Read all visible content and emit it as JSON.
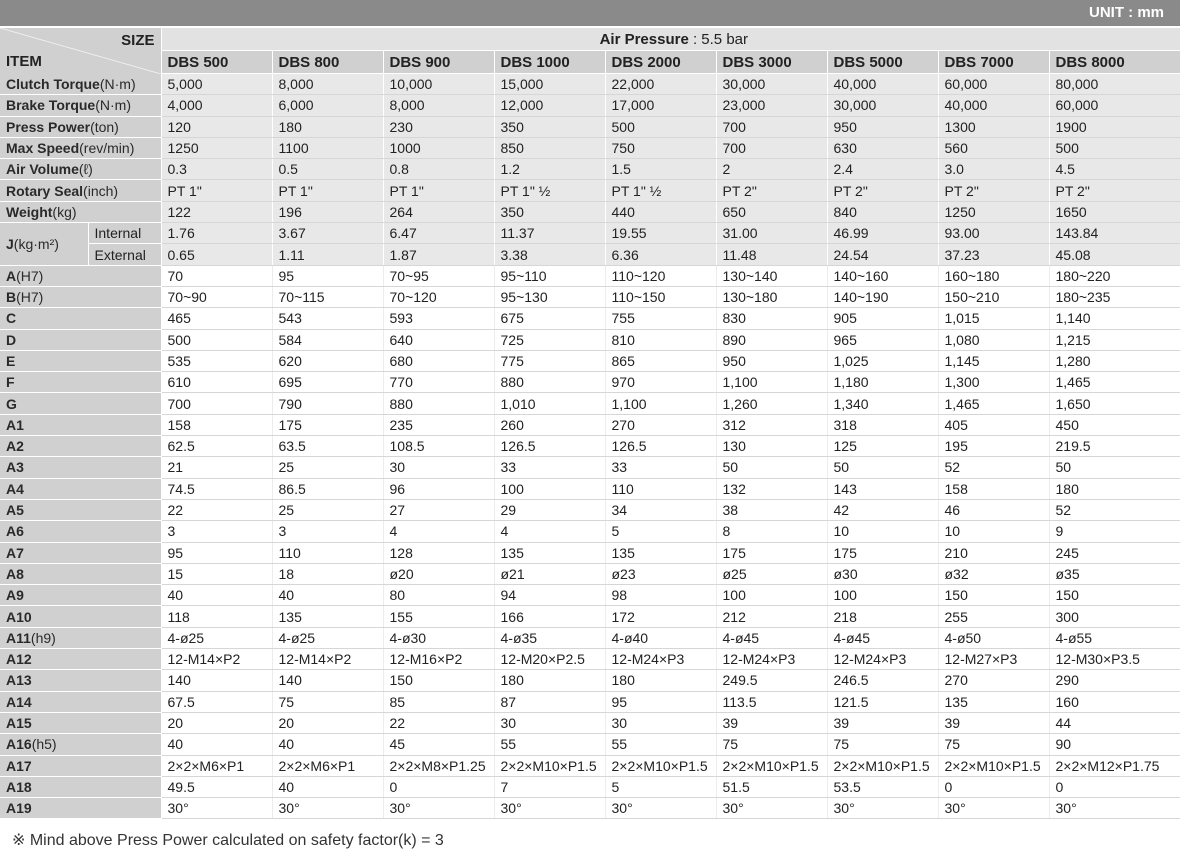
{
  "unit": "UNIT : mm",
  "header": {
    "size_label": "SIZE",
    "item_label": "ITEM",
    "air_pressure_label": "Air Pressure",
    "air_pressure_value": " : 5.5 bar",
    "models": [
      "DBS 500",
      "DBS 800",
      "DBS 900",
      "DBS 1000",
      "DBS 2000",
      "DBS 3000",
      "DBS 5000",
      "DBS 7000",
      "DBS 8000"
    ]
  },
  "groups": [
    {
      "rows": [
        {
          "label": "Clutch Torque",
          "unit": "(N·m)",
          "values": [
            "5,000",
            "8,000",
            "10,000",
            "15,000",
            "22,000",
            "30,000",
            "40,000",
            "60,000",
            "80,000"
          ]
        },
        {
          "label": "Brake Torque",
          "unit": "(N·m)",
          "values": [
            "4,000",
            "6,000",
            "8,000",
            "12,000",
            "17,000",
            "23,000",
            "30,000",
            "40,000",
            "60,000"
          ]
        },
        {
          "label": "Press Power",
          "unit": "(ton)",
          "values": [
            "120",
            "180",
            "230",
            "350",
            "500",
            "700",
            "950",
            "1300",
            "1900"
          ]
        },
        {
          "label": "Max Speed",
          "unit": "(rev/min)",
          "values": [
            "1250",
            "1100",
            "1000",
            "850",
            "750",
            "700",
            "630",
            "560",
            "500"
          ]
        },
        {
          "label": "Air Volume",
          "unit": "(ℓ)",
          "values": [
            "0.3",
            "0.5",
            "0.8",
            "1.2",
            "1.5",
            "2",
            "2.4",
            "3.0",
            "4.5"
          ]
        },
        {
          "label": "Rotary Seal",
          "unit": "(inch)",
          "values": [
            "PT 1\"",
            "PT 1\"",
            "PT 1\"",
            "PT 1\" ½",
            "PT 1\" ½",
            "PT 2\"",
            "PT 2\"",
            "PT 2\"",
            "PT 2\""
          ]
        },
        {
          "label": "Weight",
          "unit": "(kg)",
          "values": [
            "122",
            "196",
            "264",
            "350",
            "440",
            "650",
            "840",
            "1250",
            "1650"
          ]
        }
      ],
      "j_label": "J",
      "j_unit": "(kg·m²)",
      "j_rows": [
        {
          "label": "Internal",
          "values": [
            "1.76",
            "3.67",
            "6.47",
            "11.37",
            "19.55",
            "31.00",
            "46.99",
            "93.00",
            "143.84"
          ]
        },
        {
          "label": "External",
          "values": [
            "0.65",
            "1.11",
            "1.87",
            "3.38",
            "6.36",
            "11.48",
            "24.54",
            "37.23",
            "45.08"
          ]
        }
      ]
    },
    {
      "rows": [
        {
          "label": "A",
          "unit": "(H7)",
          "values": [
            "70",
            "95",
            "70~95",
            "95~110",
            "110~120",
            "130~140",
            "140~160",
            "160~180",
            "180~220"
          ]
        },
        {
          "label": "B",
          "unit": "(H7)",
          "values": [
            "70~90",
            "70~115",
            "70~120",
            "95~130",
            "110~150",
            "130~180",
            "140~190",
            "150~210",
            "180~235"
          ]
        },
        {
          "label": "C",
          "unit": "",
          "values": [
            "465",
            "543",
            "593",
            "675",
            "755",
            "830",
            "905",
            "1,015",
            "1,140"
          ]
        },
        {
          "label": "D",
          "unit": "",
          "values": [
            "500",
            "584",
            "640",
            "725",
            "810",
            "890",
            "965",
            "1,080",
            "1,215"
          ]
        },
        {
          "label": "E",
          "unit": "",
          "values": [
            "535",
            "620",
            "680",
            "775",
            "865",
            "950",
            "1,025",
            "1,145",
            "1,280"
          ]
        },
        {
          "label": "F",
          "unit": "",
          "values": [
            "610",
            "695",
            "770",
            "880",
            "970",
            "1,100",
            "1,180",
            "1,300",
            "1,465"
          ]
        },
        {
          "label": "G",
          "unit": "",
          "values": [
            "700",
            "790",
            "880",
            "1,010",
            "1,100",
            "1,260",
            "1,340",
            "1,465",
            "1,650"
          ]
        }
      ]
    },
    {
      "rows": [
        {
          "label": "A1",
          "unit": "",
          "values": [
            "158",
            "175",
            "235",
            "260",
            "270",
            "312",
            "318",
            "405",
            "450"
          ]
        },
        {
          "label": "A2",
          "unit": "",
          "values": [
            "62.5",
            "63.5",
            "108.5",
            "126.5",
            "126.5",
            "130",
            "125",
            "195",
            "219.5"
          ]
        },
        {
          "label": "A3",
          "unit": "",
          "values": [
            "21",
            "25",
            "30",
            "33",
            "33",
            "50",
            "50",
            "52",
            "50"
          ]
        },
        {
          "label": "A4",
          "unit": "",
          "values": [
            "74.5",
            "86.5",
            "96",
            "100",
            "110",
            "132",
            "143",
            "158",
            "180"
          ]
        },
        {
          "label": "A5",
          "unit": "",
          "values": [
            "22",
            "25",
            "27",
            "29",
            "34",
            "38",
            "42",
            "46",
            "52"
          ]
        },
        {
          "label": "A6",
          "unit": "",
          "values": [
            "3",
            "3",
            "4",
            "4",
            "5",
            "8",
            "10",
            "10",
            "9"
          ]
        },
        {
          "label": "A7",
          "unit": "",
          "values": [
            "95",
            "110",
            "128",
            "135",
            "135",
            "175",
            "175",
            "210",
            "245"
          ]
        },
        {
          "label": "A8",
          "unit": "",
          "values": [
            "15",
            "18",
            "ø20",
            "ø21",
            "ø23",
            "ø25",
            "ø30",
            "ø32",
            "ø35"
          ]
        },
        {
          "label": "A9",
          "unit": "",
          "values": [
            "40",
            "40",
            "80",
            "94",
            "98",
            "100",
            "100",
            "150",
            "150"
          ]
        },
        {
          "label": "A10",
          "unit": "",
          "values": [
            "118",
            "135",
            "155",
            "166",
            "172",
            "212",
            "218",
            "255",
            "300"
          ]
        },
        {
          "label": "A11",
          "unit": "(h9)",
          "values": [
            "4-ø25",
            "4-ø25",
            "4-ø30",
            "4-ø35",
            "4-ø40",
            "4-ø45",
            "4-ø45",
            "4-ø50",
            "4-ø55"
          ]
        },
        {
          "label": "A12",
          "unit": "",
          "values": [
            "12-M14×P2",
            "12-M14×P2",
            "12-M16×P2",
            "12-M20×P2.5",
            "12-M24×P3",
            "12-M24×P3",
            "12-M24×P3",
            "12-M27×P3",
            "12-M30×P3.5"
          ]
        },
        {
          "label": "A13",
          "unit": "",
          "values": [
            "140",
            "140",
            "150",
            "180",
            "180",
            "249.5",
            "246.5",
            "270",
            "290"
          ]
        },
        {
          "label": "A14",
          "unit": "",
          "values": [
            "67.5",
            "75",
            "85",
            "87",
            "95",
            "113.5",
            "121.5",
            "135",
            "160"
          ]
        },
        {
          "label": "A15",
          "unit": "",
          "values": [
            "20",
            "20",
            "22",
            "30",
            "30",
            "39",
            "39",
            "39",
            "44"
          ]
        },
        {
          "label": "A16",
          "unit": "(h5)",
          "values": [
            "40",
            "40",
            "45",
            "55",
            "55",
            "75",
            "75",
            "75",
            "90"
          ]
        },
        {
          "label": "A17",
          "unit": "",
          "values": [
            "2×2×M6×P1",
            "2×2×M6×P1",
            "2×2×M8×P1.25",
            "2×2×M10×P1.5",
            "2×2×M10×P1.5",
            "2×2×M10×P1.5",
            "2×2×M10×P1.5",
            "2×2×M10×P1.5",
            "2×2×M12×P1.75"
          ]
        },
        {
          "label": "A18",
          "unit": "",
          "values": [
            "49.5",
            "40",
            "0",
            "7",
            "5",
            "51.5",
            "53.5",
            "0",
            "0"
          ]
        },
        {
          "label": "A19",
          "unit": "",
          "values": [
            "30°",
            "30°",
            "30°",
            "30°",
            "30°",
            "30°",
            "30°",
            "30°",
            "30°"
          ]
        }
      ]
    }
  ],
  "note": "※ Mind above Press Power calculated on safety factor(k) = 3"
}
